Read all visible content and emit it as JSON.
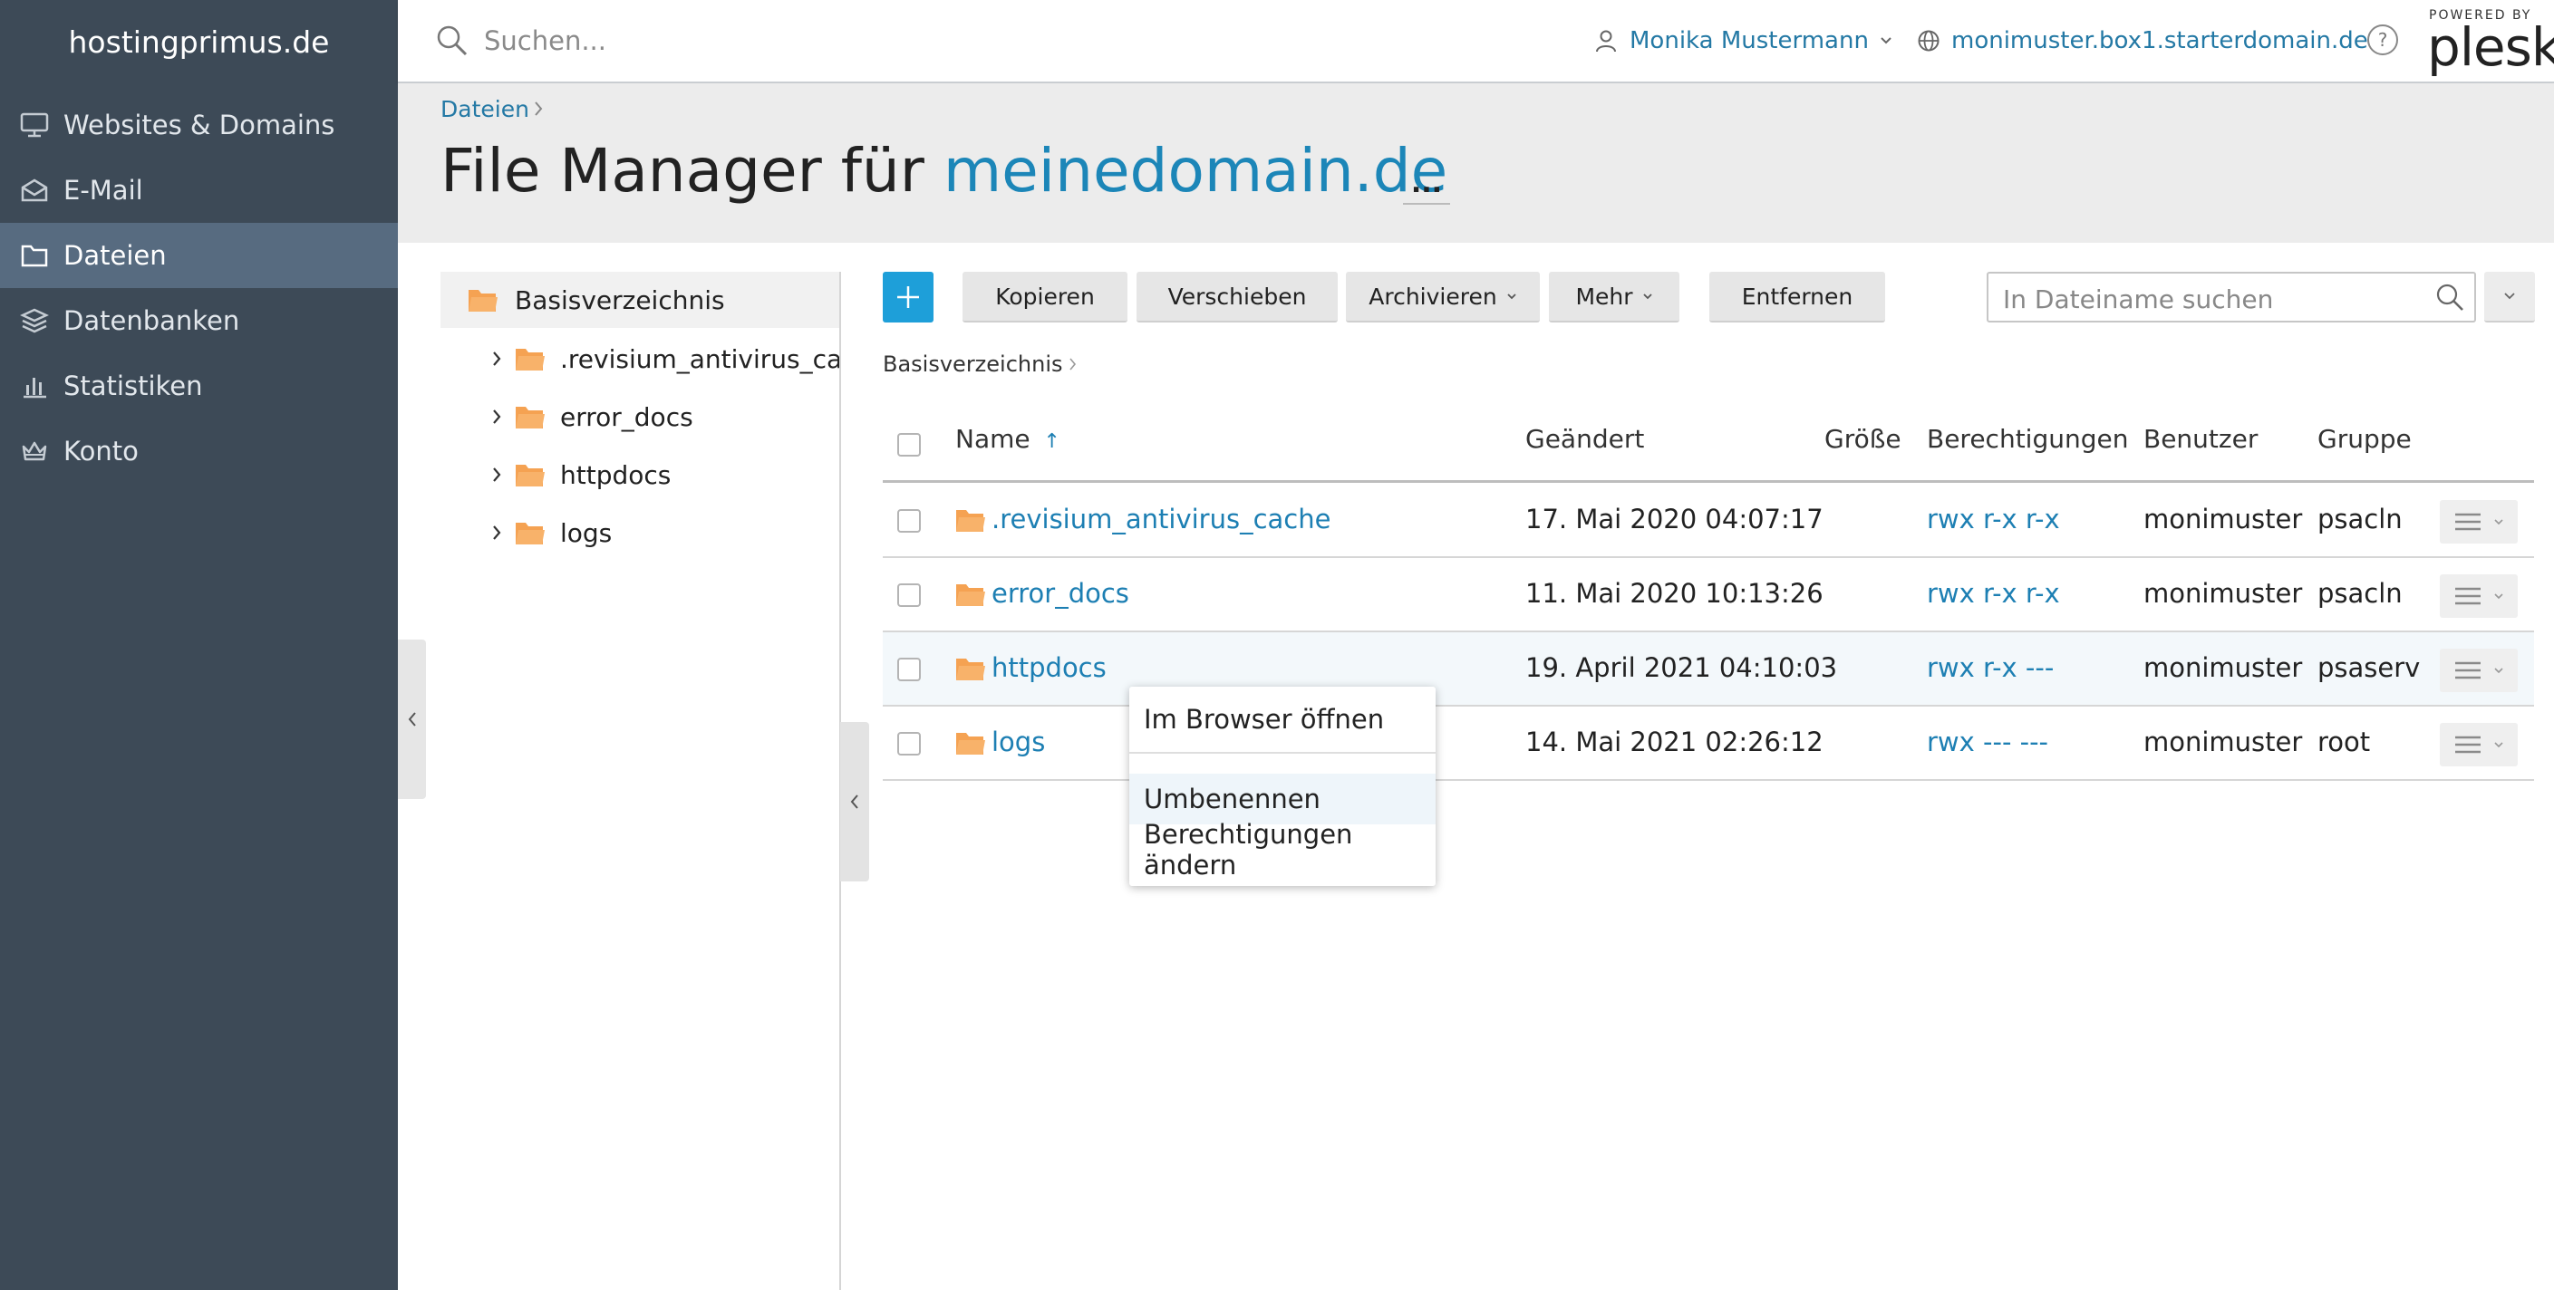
{
  "sidebar": {
    "brand": "hostingprimus.de",
    "items": [
      {
        "label": "Websites & Domains",
        "icon": "monitor-icon"
      },
      {
        "label": "E-Mail",
        "icon": "envelope-icon"
      },
      {
        "label": "Dateien",
        "icon": "folder-icon",
        "active": true
      },
      {
        "label": "Datenbanken",
        "icon": "database-layers-icon"
      },
      {
        "label": "Statistiken",
        "icon": "bar-chart-icon"
      },
      {
        "label": "Konto",
        "icon": "crown-icon"
      }
    ]
  },
  "topbar": {
    "search_placeholder": "Suchen...",
    "user_name": "Monika Mustermann",
    "domain": "monimuster.box1.starterdomain.de",
    "help": "?",
    "powered_by": "POWERED BY",
    "logo": "plesk"
  },
  "header": {
    "breadcrumb": "Dateien",
    "title_prefix": "File Manager für",
    "title_domain": "meinedomain.de",
    "more": "..."
  },
  "tree": {
    "root": "Basisverzeichnis",
    "items": [
      ".revisium_antivirus_cache",
      "error_docs",
      "httpdocs",
      "logs"
    ]
  },
  "toolbar": {
    "copy": "Kopieren",
    "move": "Verschieben",
    "archive": "Archivieren",
    "more": "Mehr",
    "remove": "Entfernen",
    "search_placeholder": "In Dateiname suchen"
  },
  "path": "Basisverzeichnis",
  "table": {
    "columns": {
      "name": "Name",
      "sort_indicator": "↑",
      "modified": "Geändert",
      "size": "Größe",
      "permissions": "Berechtigungen",
      "user": "Benutzer",
      "group": "Gruppe"
    },
    "rows": [
      {
        "name": ".revisium_antivirus_cache",
        "modified": "17. Mai 2020 04:07:17",
        "permissions": "rwx r-x r-x",
        "user": "monimuster",
        "group": "psacln"
      },
      {
        "name": "error_docs",
        "modified": "11. Mai 2020 10:13:26",
        "permissions": "rwx r-x r-x",
        "user": "monimuster",
        "group": "psacln"
      },
      {
        "name": "httpdocs",
        "modified": "19. April 2021 04:10:03",
        "permissions": "rwx r-x ---",
        "user": "monimuster",
        "group": "psaserv"
      },
      {
        "name": "logs",
        "modified": "14. Mai 2021 02:26:12",
        "permissions": "rwx --- ---",
        "user": "monimuster",
        "group": "root"
      }
    ]
  },
  "context_menu": {
    "open_in_browser": "Im Browser öffnen",
    "rename": "Umbenennen",
    "change_permissions": "Berechtigungen ändern"
  },
  "colors": {
    "sidebar_bg": "#3d4a57",
    "sidebar_active": "#576b80",
    "link": "#1d7fb3",
    "accent_button": "#1e9fd9",
    "folder": "#f5a252"
  }
}
